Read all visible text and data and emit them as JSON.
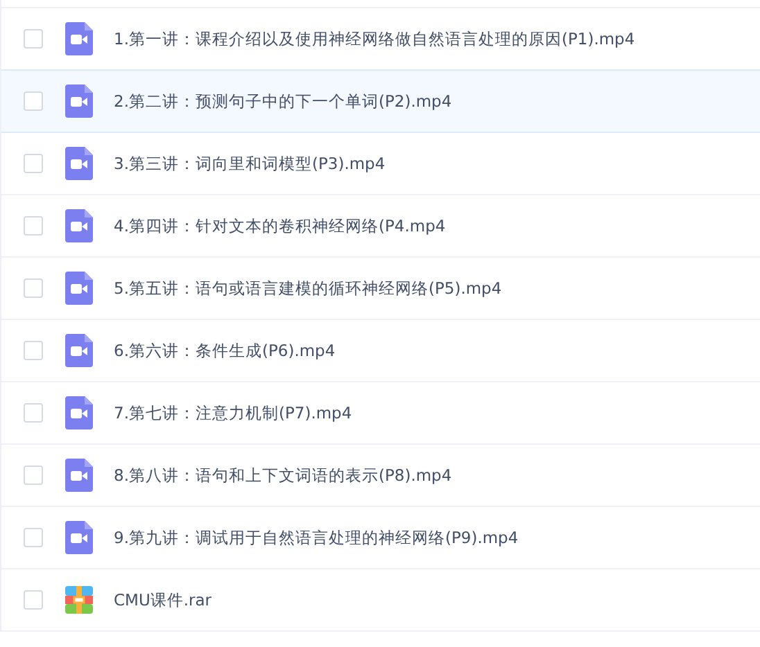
{
  "files": [
    {
      "name": "1.第一讲：课程介绍以及使用神经网络做自然语言处理的原因(P1).mp4",
      "kind": "video",
      "checked": false,
      "selected": false
    },
    {
      "name": "2.第二讲：预测句子中的下一个单词(P2).mp4",
      "kind": "video",
      "checked": false,
      "selected": true
    },
    {
      "name": "3.第三讲：词向里和词模型(P3).mp4",
      "kind": "video",
      "checked": false,
      "selected": false
    },
    {
      "name": "4.第四讲：针对文本的卷积神经网络(P4.mp4",
      "kind": "video",
      "checked": false,
      "selected": false
    },
    {
      "name": "5.第五讲：语句或语言建模的循环神经网络(P5).mp4",
      "kind": "video",
      "checked": false,
      "selected": false
    },
    {
      "name": "6.第六讲：条件生成(P6).mp4",
      "kind": "video",
      "checked": false,
      "selected": false
    },
    {
      "name": "7.第七讲：注意力机制(P7).mp4",
      "kind": "video",
      "checked": false,
      "selected": false
    },
    {
      "name": "8.第八讲：语句和上下文词语的表示(P8).mp4",
      "kind": "video",
      "checked": false,
      "selected": false
    },
    {
      "name": "9.第九讲：调试用于自然语言处理的神经网络(P9).mp4",
      "kind": "video",
      "checked": false,
      "selected": false
    },
    {
      "name": "CMU课件.rar",
      "kind": "archive",
      "checked": false,
      "selected": false
    }
  ]
}
